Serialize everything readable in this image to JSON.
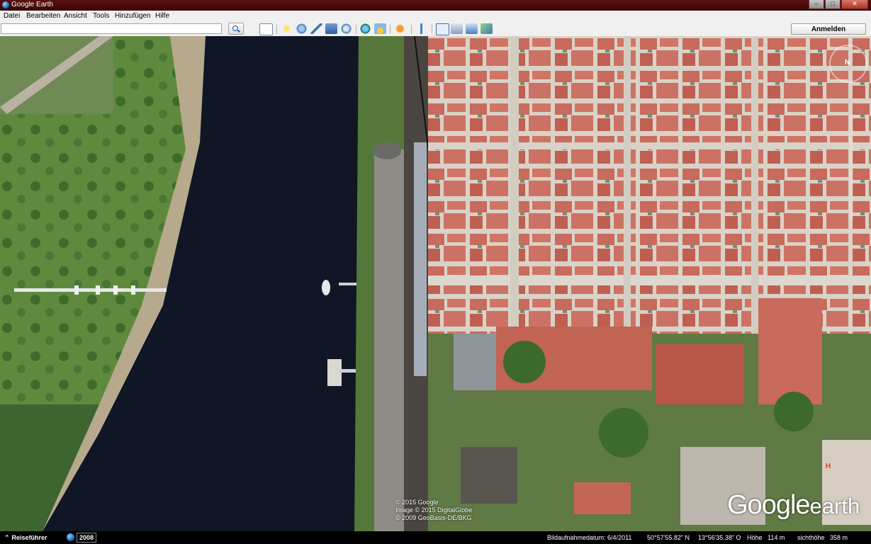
{
  "window": {
    "title": "Google Earth",
    "close_glyph": "✕",
    "minimize_glyph": "–",
    "maximize_glyph": "□"
  },
  "menu": [
    "Datei",
    "Bearbeiten",
    "Ansicht",
    "Tools",
    "Hinzufügen",
    "Hilfe"
  ],
  "search": {
    "value": "",
    "placeholder": ""
  },
  "toolbar": {
    "icons": [
      "sidebar-toggle-icon",
      "placemark-icon",
      "polygon-icon",
      "path-icon",
      "image-overlay-icon",
      "record-tour-icon",
      "historical-imagery-icon",
      "sunlight-icon",
      "planets-icon",
      "ruler-icon",
      "email-icon",
      "print-icon",
      "save-image-icon",
      "maps-view-icon"
    ],
    "signin_label": "Anmelden"
  },
  "map": {
    "copyright": [
      "© 2015 Google",
      "Image © 2015 DigitalGlobe",
      "© 2009 GeoBasis-DE/BKG"
    ],
    "logo_word1": "Google",
    "logo_word2": "earth",
    "compass_label": "N",
    "hotel_label": "H"
  },
  "status": {
    "tour_guide": "Reiseführer",
    "historical_year": "2008",
    "image_date": "Bildaufnahmedatum: 6/4/2011",
    "latitude": "50°57'55.82\" N",
    "longitude": "13°56'35.38\" O",
    "elevation": "Höhe   114 m",
    "eye_alt": "sichthöhe   358 m"
  },
  "colors": {
    "titlebar": "#4a0c0c",
    "water": "#0f1523",
    "rooftop": "#c8685a",
    "grass": "#5d8a3e"
  }
}
